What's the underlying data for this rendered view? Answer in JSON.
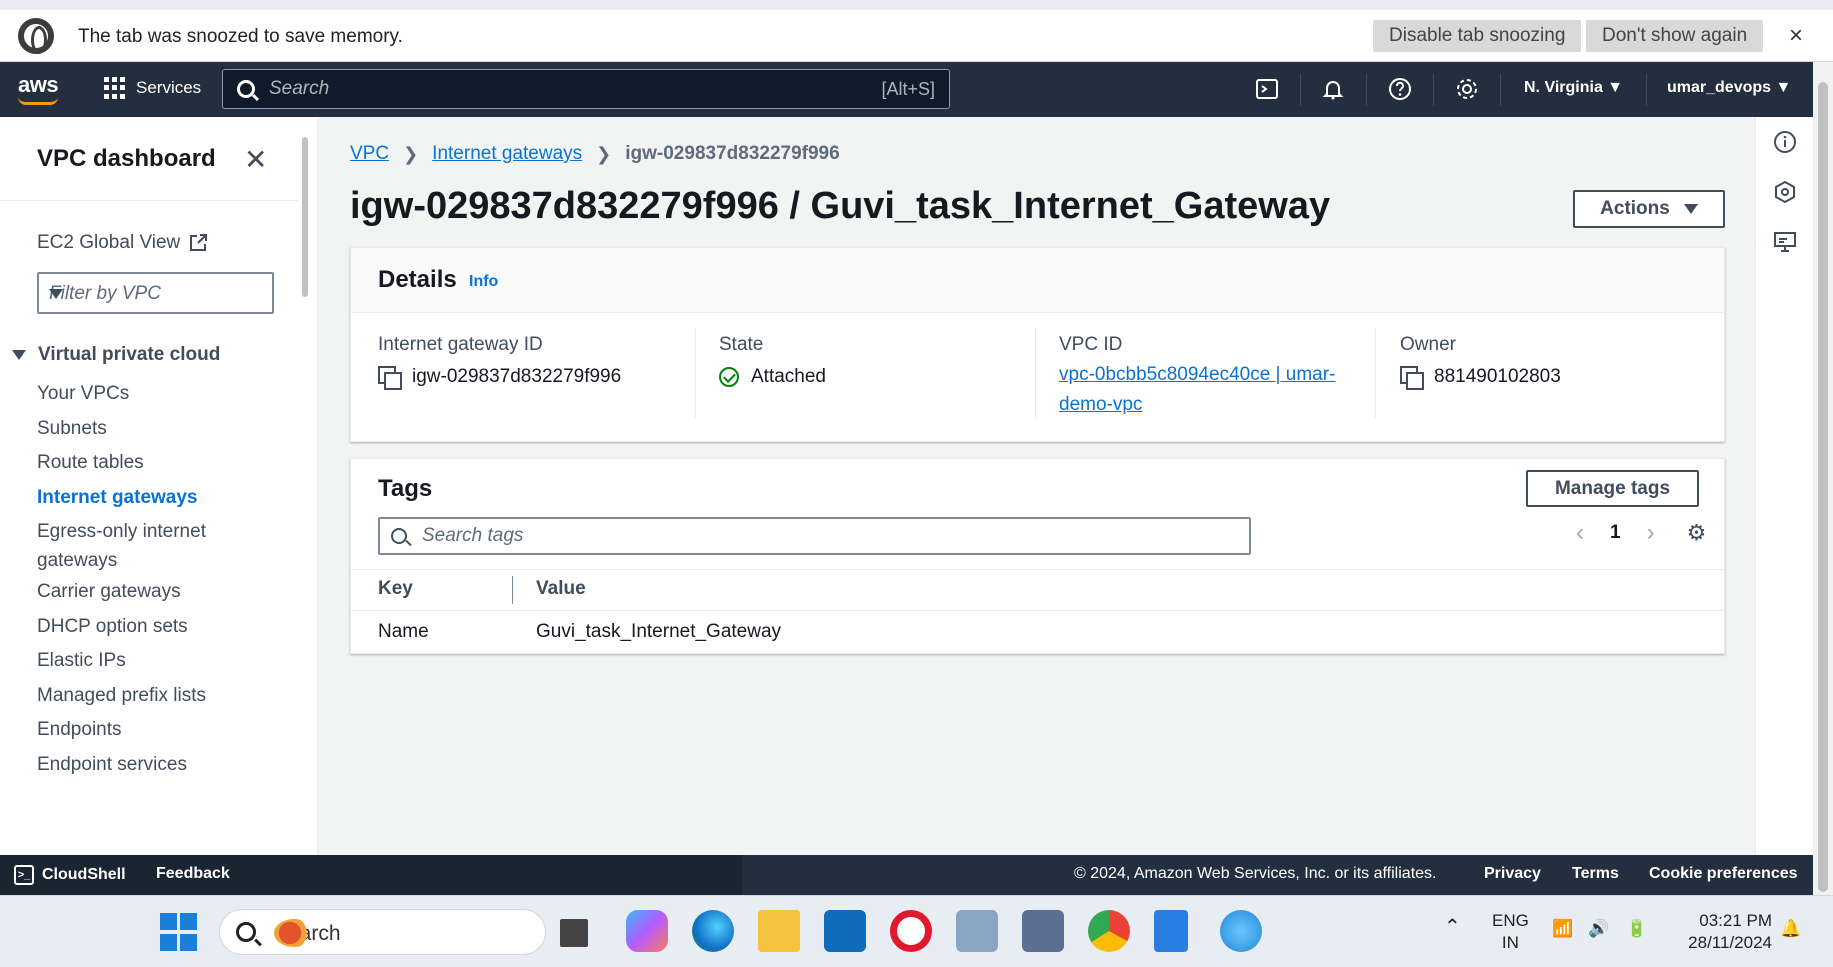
{
  "browser": {
    "snooze_message": "The tab was snoozed to save memory.",
    "disable_label": "Disable tab snoozing",
    "dont_show_label": "Don't show again",
    "close_symbol": "×"
  },
  "topnav": {
    "logo": "aws",
    "services_label": "Services",
    "search_placeholder": "Search",
    "search_shortcut": "[Alt+S]",
    "region": "N. Virginia",
    "user": "umar_devops",
    "icons": [
      "cloudshell-icon",
      "bell-icon",
      "help-icon",
      "settings-icon"
    ]
  },
  "sidebar": {
    "title": "VPC dashboard",
    "ec2_global_view": "EC2 Global View",
    "filter_placeholder": "Filter by VPC",
    "section": "Virtual private cloud",
    "items": [
      {
        "label": "Your VPCs"
      },
      {
        "label": "Subnets"
      },
      {
        "label": "Route tables"
      },
      {
        "label": "Internet gateways",
        "active": true
      },
      {
        "label": "Egress-only internet gateways"
      },
      {
        "label": "Carrier gateways"
      },
      {
        "label": "DHCP option sets"
      },
      {
        "label": "Elastic IPs"
      },
      {
        "label": "Managed prefix lists"
      },
      {
        "label": "Endpoints"
      },
      {
        "label": "Endpoint services"
      }
    ]
  },
  "breadcrumb": {
    "vpc": "VPC",
    "internet_gateways": "Internet gateways",
    "current": "igw-029837d832279f996"
  },
  "page": {
    "title": "igw-029837d832279f996 / Guvi_task_Internet_Gateway",
    "actions_label": "Actions"
  },
  "details": {
    "heading": "Details",
    "info_link": "Info",
    "igw_id_label": "Internet gateway ID",
    "igw_id": "igw-029837d832279f996",
    "state_label": "State",
    "state": "Attached",
    "vpc_id_label": "VPC ID",
    "vpc_id": "vpc-0bcbb5c8094ec40ce | umar-demo-vpc",
    "owner_label": "Owner",
    "owner": "881490102803"
  },
  "tags": {
    "heading": "Tags",
    "manage_label": "Manage tags",
    "search_placeholder": "Search tags",
    "page": "1",
    "columns": [
      "Key",
      "Value"
    ],
    "rows": [
      {
        "key": "Name",
        "value": "Guvi_task_Internet_Gateway"
      }
    ]
  },
  "footer": {
    "cloudshell": "CloudShell",
    "feedback": "Feedback",
    "copyright": "© 2024, Amazon Web Services, Inc. or its affiliates.",
    "privacy": "Privacy",
    "terms": "Terms",
    "cookie": "Cookie preferences"
  },
  "taskbar": {
    "search_label": "Search",
    "lang_line1": "ENG",
    "lang_line2": "IN",
    "time": "03:21 PM",
    "date": "28/11/2024"
  },
  "colors": {
    "nav_bg": "#232f3e",
    "link": "#0972d3",
    "success": "#037f0c",
    "page_bg": "#f2f3f3"
  }
}
